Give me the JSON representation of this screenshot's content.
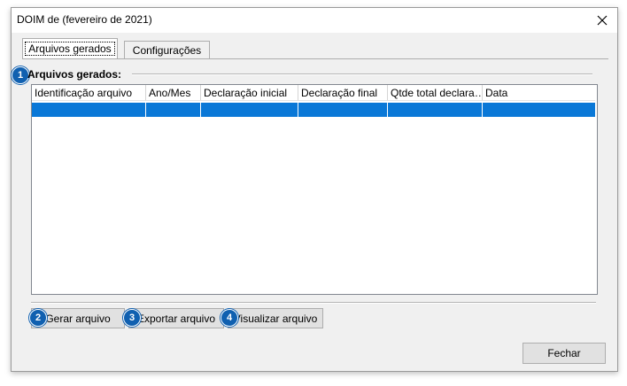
{
  "window": {
    "title": "DOIM de  (fevereiro de 2021)"
  },
  "tabs": [
    {
      "label": "Arquivos gerados"
    },
    {
      "label": "Configurações"
    }
  ],
  "group": {
    "label": "Arquivos gerados:"
  },
  "badges": [
    "1",
    "2",
    "3",
    "4"
  ],
  "table": {
    "columns": [
      "Identificação arquivo",
      "Ano/Mes",
      "Declaração inicial",
      "Declaração final",
      "Qtde total declara…",
      "Data"
    ],
    "selected_row": [
      "",
      "",
      "",
      "",
      "",
      ""
    ]
  },
  "buttons": {
    "generate": "Gerar arquivo",
    "export": "Exportar arquivo",
    "view": "Visualizar arquivo",
    "close": "Fechar"
  },
  "colors": {
    "accent": "#0a78d7",
    "badge": "#1060b0"
  }
}
